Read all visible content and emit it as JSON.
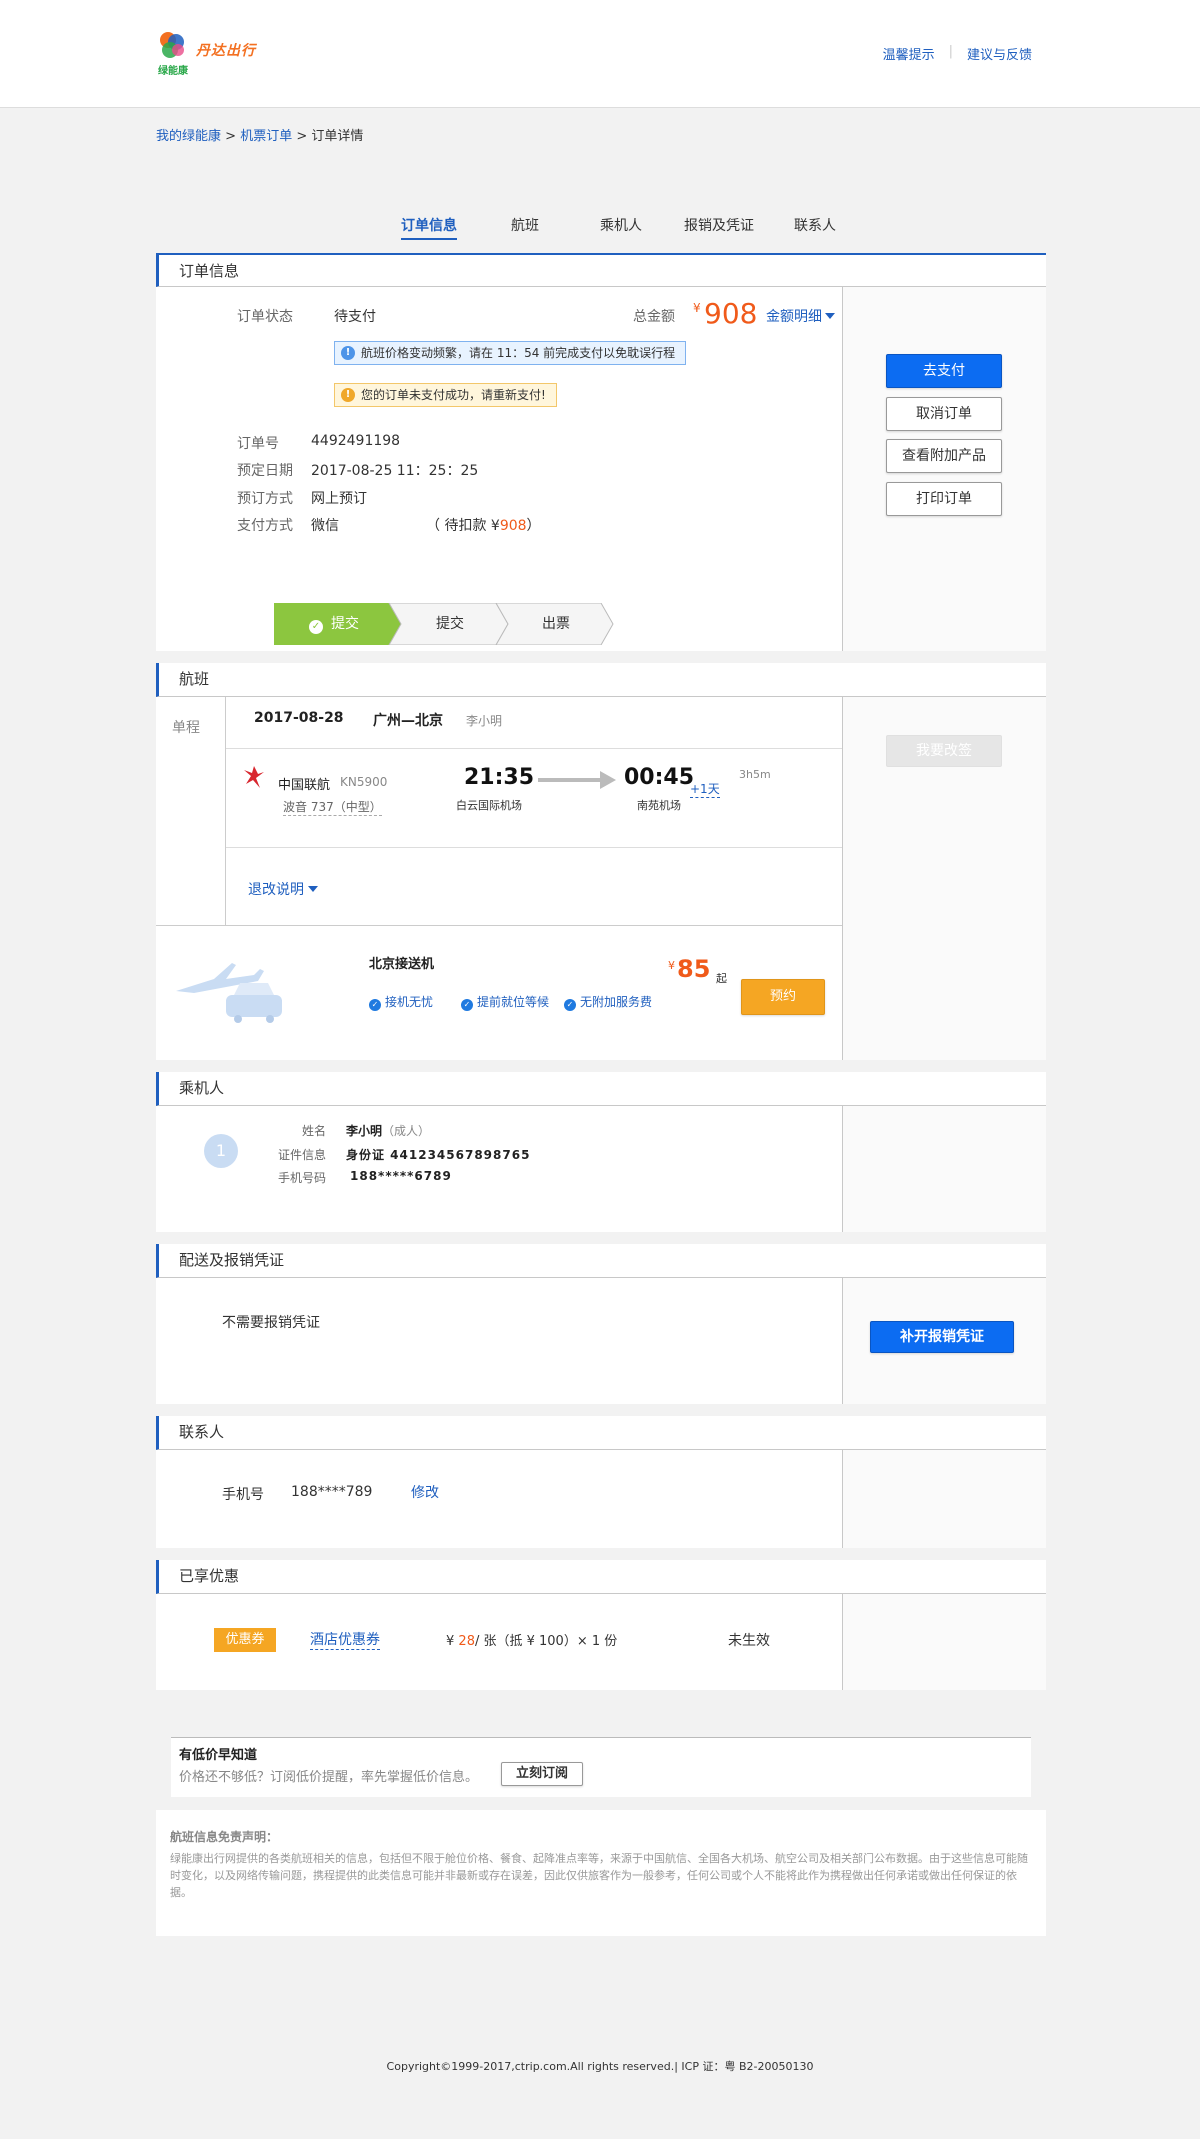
{
  "header": {
    "logo_text": "丹达出行",
    "logo_sub": "绿能康",
    "links": [
      "温馨提示",
      "建议与反馈"
    ]
  },
  "breadcrumb": {
    "items": [
      "我的绿能康",
      "机票订单"
    ],
    "current": "订单详情",
    "sep": ">"
  },
  "tabs": [
    "订单信息",
    "航班",
    "乘机人",
    "报销及凭证",
    "联系人"
  ],
  "order": {
    "title": "订单信息",
    "status_label": "订单状态",
    "status_value": "待支付",
    "total_label": "总金额",
    "currency": "¥",
    "total_value": "908",
    "detail_link": "金额明细",
    "notice_blue": "航班价格变动频繁，请在 11：54 前完成支付以免耽误行程",
    "notice_yellow": "您的订单未支付成功，请重新支付!",
    "fields": [
      {
        "label": "订单号",
        "value": "4492491198"
      },
      {
        "label": "预定日期",
        "value": "2017-08-25 11：25：25"
      },
      {
        "label": "预订方式",
        "value": "网上预订"
      },
      {
        "label": "支付方式",
        "value": "微信"
      }
    ],
    "pending_prefix": "（ 待扣款 ¥",
    "pending_amount": "908",
    "pending_suffix": "）",
    "steps": [
      "提交",
      "提交",
      "出票"
    ],
    "buttons": [
      "去支付",
      "取消订单",
      "查看附加产品",
      "打印订单"
    ]
  },
  "flight": {
    "title": "航班",
    "trip_type": "单程",
    "date": "2017-08-28",
    "route": "广州—北京",
    "passenger": "李小明",
    "airline": "中国联航",
    "flight_no": "KN5900",
    "aircraft": "波音 737（中型）",
    "dep_time": "21:35",
    "dep_airport": "白云国际机场",
    "arr_time": "00:45",
    "next_day": "+1天",
    "arr_airport": "南苑机场",
    "duration": "3h5m",
    "refund_link": "退改说明",
    "change_button": "我要改签",
    "transfer": {
      "title": "北京接送机",
      "features": [
        "接机无忧",
        "提前就位等候",
        "无附加服务费"
      ],
      "currency": "¥",
      "price": "85",
      "price_suffix": "起",
      "button": "预约"
    }
  },
  "passengers": {
    "title": "乘机人",
    "index": "1",
    "name_label": "姓名",
    "name": "李小明",
    "name_type": "（成人）",
    "id_label": "证件信息",
    "id_value": "身份证 441234567898765",
    "phone_label": "手机号码",
    "phone_value": "188*****6789"
  },
  "delivery": {
    "title": "配送及报销凭证",
    "text": "不需要报销凭证",
    "button": "补开报销凭证"
  },
  "contact": {
    "title": "联系人",
    "label": "手机号",
    "value": "188****789",
    "edit": "修改"
  },
  "discount": {
    "title": "已享优惠",
    "badge": "优惠券",
    "name": "酒店优惠券",
    "price_prefix": "¥",
    "price": "28",
    "price_suffix": "/ 张（抵 ¥ 100）× 1 份",
    "status": "未生效"
  },
  "lowprice": {
    "title": "有低价早知道",
    "text": "价格还不够低？订阅低价提醒，率先掌握低价信息。",
    "button": "立刻订阅"
  },
  "disclaimer": {
    "title": "航班信息免责声明：",
    "text": "绿能康出行网提供的各类航班相关的信息，包括但不限于舱位价格、餐食、起降准点率等，来源于中国航信、全国各大机场、航空公司及相关部门公布数据。由于这些信息可能随时变化，以及网络传输问题，携程提供的此类信息可能并非最新或存在误差，因此仅供旅客作为一般参考，任何公司或个人不能将此作为携程做出任何承诺或做出任何保证的依据。"
  },
  "footer": {
    "text": "Copyright©1999-2017,ctrip.com.All rights reserved.| ICP 证：粤 B2-20050130"
  },
  "colors": {
    "accent": "#1f5fbf",
    "primary_button": "#0c6cf2",
    "price": "#f05a1a",
    "step_done": "#8cc63f",
    "orange_button": "#f5a623"
  }
}
